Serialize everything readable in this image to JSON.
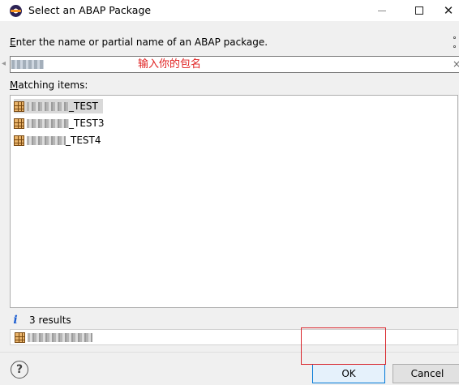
{
  "window": {
    "title": "Select an ABAP Package",
    "min_icon": "minimize-icon",
    "max_icon": "maximize-icon",
    "close_glyph": "✕"
  },
  "prompt": {
    "accel": "E",
    "rest": "nter the name or partial name of an ABAP package."
  },
  "search": {
    "value": "",
    "hint": "输入你的包名",
    "clear_glyph": "×"
  },
  "matching": {
    "accel": "M",
    "rest": "atching items:"
  },
  "items": [
    {
      "suffix": "_TEST",
      "icon": "package-icon",
      "selected": true
    },
    {
      "suffix": "_TEST3",
      "icon": "package-icon",
      "selected": false
    },
    {
      "suffix": "_TEST4",
      "icon": "package-icon",
      "selected": false
    }
  ],
  "status": {
    "results_text": "3 results",
    "info_icon_glyph": "i"
  },
  "buttons": {
    "ok_label": "OK",
    "cancel_label": "Cancel",
    "help_glyph": "?"
  },
  "colors": {
    "accent": "#0078d7",
    "hint_red": "#e02020",
    "annotation_red": "#d9262c"
  }
}
